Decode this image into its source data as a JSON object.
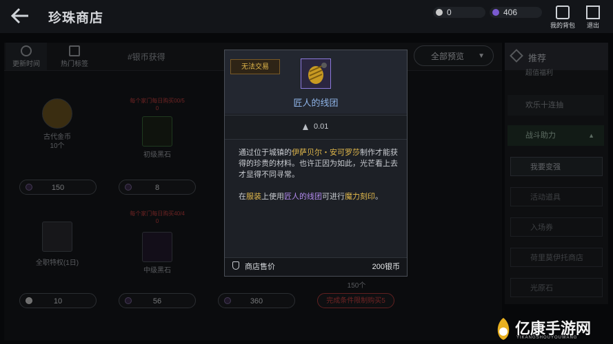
{
  "header": {
    "title": "珍珠商店",
    "currency_silver": "0",
    "currency_purple": "406",
    "bag_label": "我的背包",
    "exit_label": "退出"
  },
  "tabs": {
    "update_time": "更新时间",
    "hot_tags": "热门标签",
    "search_hint": "#银币获得",
    "filter_label": "全部预览"
  },
  "items": [
    {
      "limit": "",
      "name": "古代金币",
      "sub": "10个",
      "price": "150"
    },
    {
      "limit": "每个家门每日购买00/5",
      "limit2": "0",
      "name": "初级黑石",
      "sub": "",
      "price": "8"
    },
    {
      "limit": "",
      "name": "全职特权(1日)",
      "sub": "",
      "price": "10"
    },
    {
      "limit": "每个家门每日购买40/4",
      "limit2": "0",
      "name": "中级黑石",
      "sub": "",
      "price": "56"
    },
    {
      "limit": "",
      "name": "",
      "sub": "",
      "price": "360"
    },
    {
      "limit": "",
      "name": "",
      "sub": "150个",
      "price": "完成条件限制购买5"
    }
  ],
  "sidebar": {
    "header": "推荐",
    "items": [
      "超值福利",
      "欢乐十连抽",
      "战斗助力"
    ],
    "subitems": [
      "我要变强",
      "活动道具",
      "入场券",
      "荷里莫伊托商店",
      "光原石"
    ]
  },
  "tooltip": {
    "badge": "无法交易",
    "name": "匠人的线团",
    "weight": "0.01",
    "desc_a": "通过位于城镇的",
    "desc_hl1": "伊萨贝尔・安可罗莎",
    "desc_b": "制作才能获得的珍贵的材料。也许正因为如此，光芒看上去才显得不同寻常。",
    "desc2_a": "在",
    "desc2_hl1": "服装",
    "desc2_b": "上使用",
    "desc2_hl2": "匠人的线团",
    "desc2_c": "可进行",
    "desc2_hl3": "魔力刻印",
    "desc2_d": "。",
    "sell_label": "商店售价",
    "sell_price": "200银币"
  },
  "watermark": {
    "brand": "亿康手游网",
    "url": "YIKANGSHOUYOUWANG"
  },
  "colors": {
    "limit_red": "#c94040",
    "gold_text": "#e2b94c",
    "purple_text": "#b48bf0",
    "name_blue": "#8fb4e8"
  }
}
